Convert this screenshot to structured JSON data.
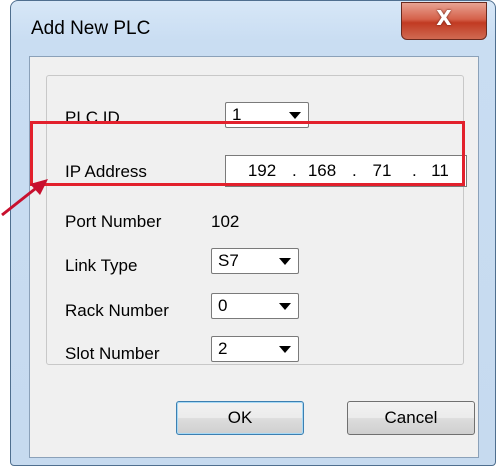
{
  "window": {
    "title": "Add New PLC",
    "close_glyph": "X"
  },
  "form": {
    "plc_id": {
      "label": "PLC ID",
      "value": "1"
    },
    "ip_address": {
      "label": "IP Address",
      "octets": [
        "192",
        "168",
        "71",
        "11"
      ],
      "separator": "."
    },
    "port_number": {
      "label": "Port Number",
      "value": "102"
    },
    "link_type": {
      "label": "Link Type",
      "value": "S7"
    },
    "rack_number": {
      "label": "Rack Number",
      "value": "0"
    },
    "slot_number": {
      "label": "Slot Number",
      "value": "2"
    }
  },
  "buttons": {
    "ok": "OK",
    "cancel": "Cancel"
  },
  "annotation": {
    "highlight_color": "#e2202c",
    "arrow_color": "#c8102e"
  }
}
